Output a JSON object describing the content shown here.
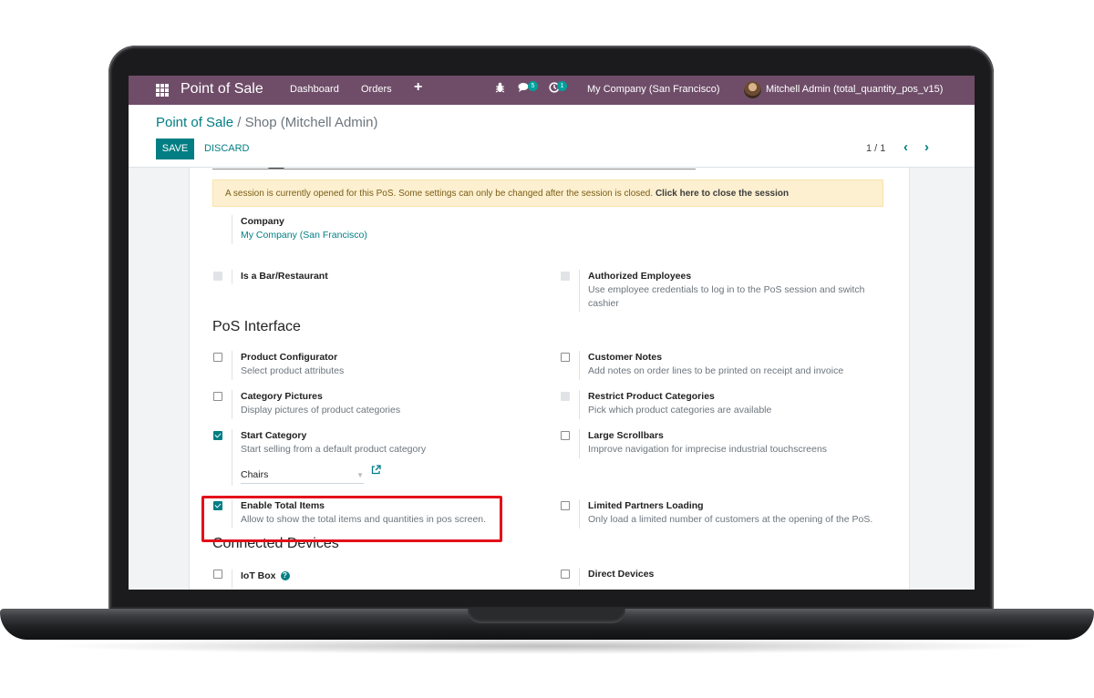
{
  "navbar": {
    "brand": "Point of Sale",
    "menu": [
      "Dashboard",
      "Orders"
    ],
    "messages_count": "5",
    "activities_count": "1",
    "company": "My Company (San Francisco)",
    "user": "Mitchell Admin (total_quantity_pos_v15)"
  },
  "breadcrumb": {
    "parent": "Point of Sale",
    "separator": "/",
    "current": "Shop (Mitchell Admin)"
  },
  "buttons": {
    "save": "SAVE",
    "discard": "DISCARD"
  },
  "pager": {
    "value": "1 / 1"
  },
  "alert": {
    "text": "A session is currently opened for this PoS. Some settings can only be changed after the session is closed.",
    "link": "Click here to close the session"
  },
  "company_field": {
    "label": "Company",
    "value": "My Company (San Francisco)"
  },
  "settings": {
    "bar_restaurant": {
      "label": "Is a Bar/Restaurant",
      "checked": false,
      "disabled": true
    },
    "authorized_employees": {
      "label": "Authorized Employees",
      "desc": "Use employee credentials to log in to the PoS session and switch cashier",
      "checked": false,
      "disabled": true
    }
  },
  "pos_interface": {
    "title": "PoS Interface",
    "product_configurator": {
      "label": "Product Configurator",
      "desc": "Select product attributes",
      "checked": false
    },
    "customer_notes": {
      "label": "Customer Notes",
      "desc": "Add notes on order lines to be printed on receipt and invoice",
      "checked": false
    },
    "category_pictures": {
      "label": "Category Pictures",
      "desc": "Display pictures of product categories",
      "checked": false
    },
    "restrict_categories": {
      "label": "Restrict Product Categories",
      "desc": "Pick which product categories are available",
      "checked": false,
      "disabled": true
    },
    "start_category": {
      "label": "Start Category",
      "desc": "Start selling from a default product category",
      "checked": true,
      "value": "Chairs"
    },
    "large_scrollbars": {
      "label": "Large Scrollbars",
      "desc": "Improve navigation for imprecise industrial touchscreens",
      "checked": false
    },
    "enable_total_items": {
      "label": "Enable Total Items",
      "desc": "Allow to show the total items and quantities in pos screen.",
      "checked": true
    },
    "limited_partners": {
      "label": "Limited Partners Loading",
      "desc": "Only load a limited number of customers at the opening of the PoS.",
      "checked": false
    }
  },
  "connected_devices": {
    "title": "Connected Devices",
    "iot_box": {
      "label": "IoT Box",
      "checked": false
    },
    "direct_devices": {
      "label": "Direct Devices",
      "checked": false
    }
  },
  "colors": {
    "navbar": "#6f4d69",
    "accent": "#017e84",
    "alert_bg": "#fdf0d0",
    "highlight": "#e3101b"
  }
}
